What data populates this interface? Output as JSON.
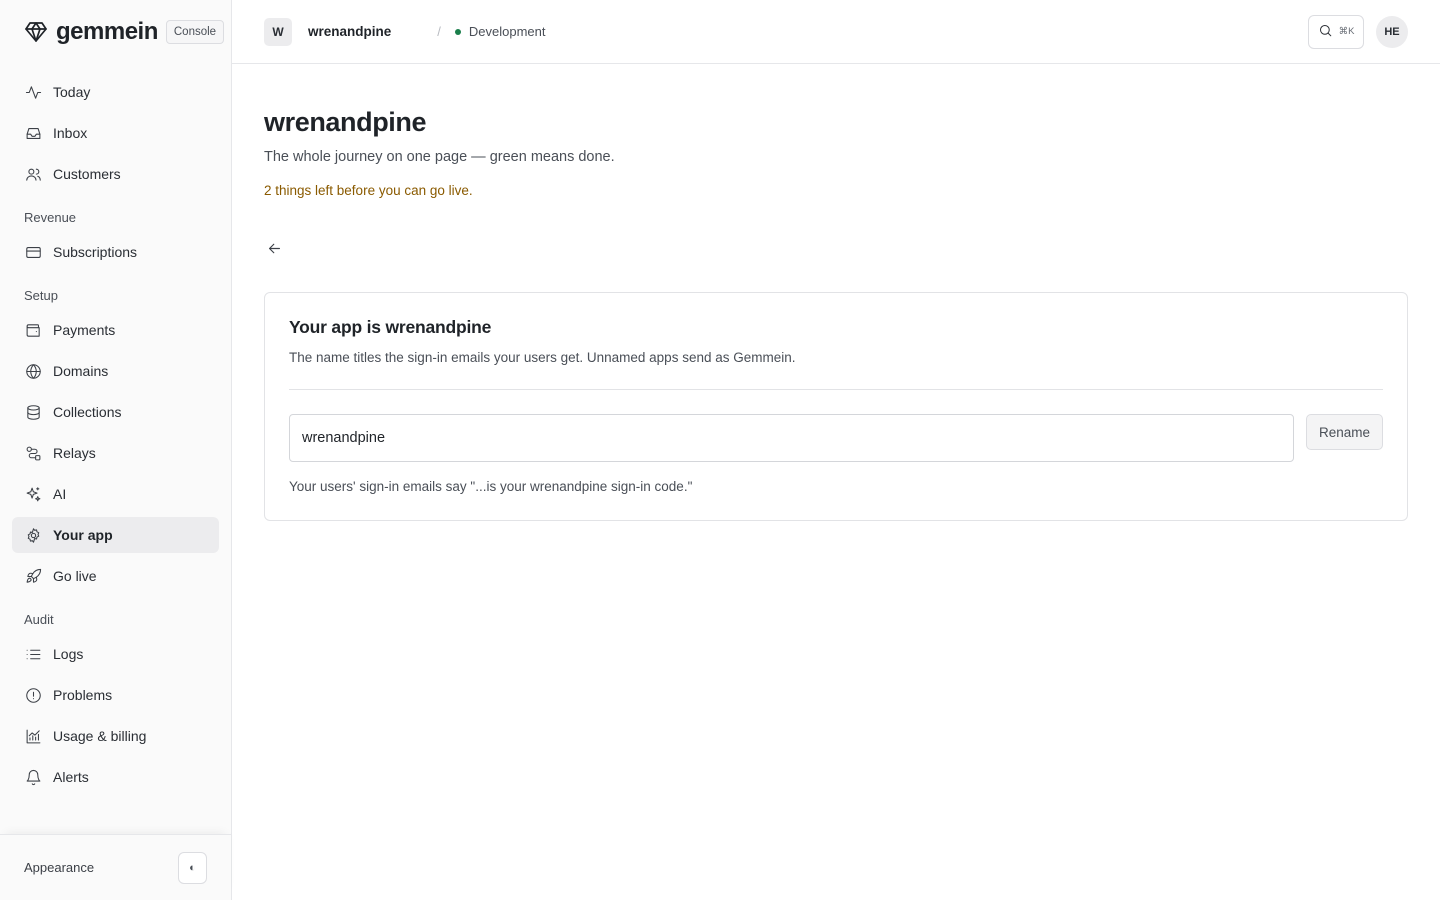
{
  "brand": {
    "name": "gemmein",
    "badge": "Console",
    "logo_icon": "diamond-icon"
  },
  "sidebar": {
    "primary": [
      {
        "label": "Today",
        "icon": "activity-icon"
      },
      {
        "label": "Inbox",
        "icon": "inbox-icon"
      },
      {
        "label": "Customers",
        "icon": "users-icon"
      }
    ],
    "groups": [
      {
        "label": "Revenue",
        "items": [
          {
            "label": "Subscriptions",
            "icon": "credit-card-icon"
          }
        ]
      },
      {
        "label": "Setup",
        "items": [
          {
            "label": "Payments",
            "icon": "wallet-icon"
          },
          {
            "label": "Domains",
            "icon": "globe-icon"
          },
          {
            "label": "Collections",
            "icon": "database-icon"
          },
          {
            "label": "Relays",
            "icon": "route-icon"
          },
          {
            "label": "AI",
            "icon": "sparkles-icon"
          },
          {
            "label": "Your app",
            "icon": "gear-icon",
            "active": true
          },
          {
            "label": "Go live",
            "icon": "rocket-icon"
          }
        ]
      },
      {
        "label": "Audit",
        "items": [
          {
            "label": "Logs",
            "icon": "list-icon"
          },
          {
            "label": "Problems",
            "icon": "alert-circle-icon"
          },
          {
            "label": "Usage & billing",
            "icon": "chart-icon"
          },
          {
            "label": "Alerts",
            "icon": "bell-icon"
          }
        ]
      }
    ],
    "footer": {
      "label": "Appearance",
      "toggle_glyph": "◐"
    }
  },
  "topbar": {
    "project_initial": "W",
    "project_name": "wrenandpine",
    "separator": "/",
    "environment": "Development",
    "environment_color": "#1a7f4b",
    "search_shortcut": "⌘K",
    "user_initials": "HE"
  },
  "page": {
    "title": "wrenandpine",
    "subtitle": "The whole journey on one page — green means done.",
    "warning": "2 things left before you can go live.",
    "warning_color": "#8a5a00"
  },
  "card": {
    "title": "Your app is wrenandpine",
    "description": "The name titles the sign-in emails your users get. Unnamed apps send as Gemmein.",
    "input_value": "wrenandpine",
    "rename_label": "Rename",
    "hint": "Your users' sign-in emails say \"...is your wrenandpine sign-in code.\""
  }
}
